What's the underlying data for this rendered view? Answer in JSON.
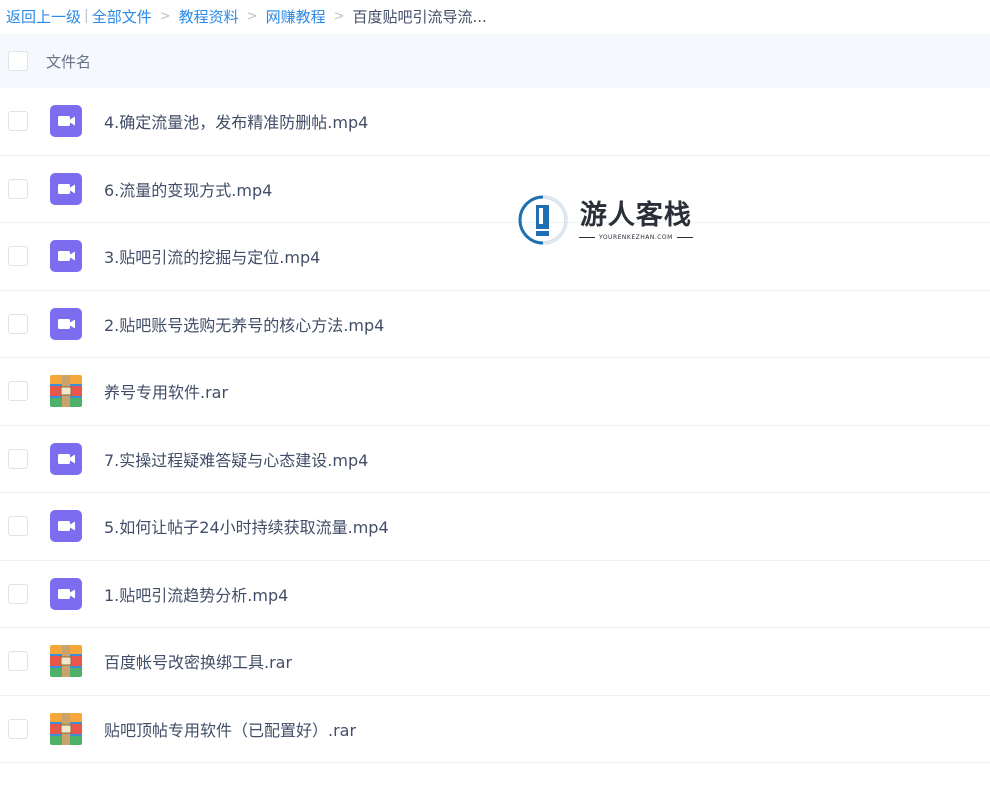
{
  "breadcrumb": {
    "back": "返回上一级",
    "items": [
      "全部文件",
      "教程资料",
      "网赚教程"
    ],
    "current": "百度贴吧引流导流..."
  },
  "header": {
    "name_label": "文件名"
  },
  "files": [
    {
      "name": "4.确定流量池，发布精准防删帖.mp4",
      "icon": "video-file-icon"
    },
    {
      "name": "6.流量的变现方式.mp4",
      "icon": "video-file-icon"
    },
    {
      "name": "3.贴吧引流的挖掘与定位.mp4",
      "icon": "video-file-icon"
    },
    {
      "name": "2.贴吧账号选购无养号的核心方法.mp4",
      "icon": "video-file-icon"
    },
    {
      "name": "养号专用软件.rar",
      "icon": "archive-file-icon"
    },
    {
      "name": "7.实操过程疑难答疑与心态建设.mp4",
      "icon": "video-file-icon"
    },
    {
      "name": "5.如何让帖子24小时持续获取流量.mp4",
      "icon": "video-file-icon"
    },
    {
      "name": "1.贴吧引流趋势分析.mp4",
      "icon": "video-file-icon"
    },
    {
      "name": "百度帐号改密换绑工具.rar",
      "icon": "archive-file-icon"
    },
    {
      "name": "贴吧顶帖专用软件（已配置好）.rar",
      "icon": "archive-file-icon"
    }
  ],
  "watermark": {
    "title": "游人客栈",
    "subtitle": "YOURENKEZHAN.COM"
  },
  "colors": {
    "link": "#2b8ae6",
    "text": "#424e67",
    "header_bg": "#f5f8fc",
    "video_icon": "#7b6cf0"
  }
}
